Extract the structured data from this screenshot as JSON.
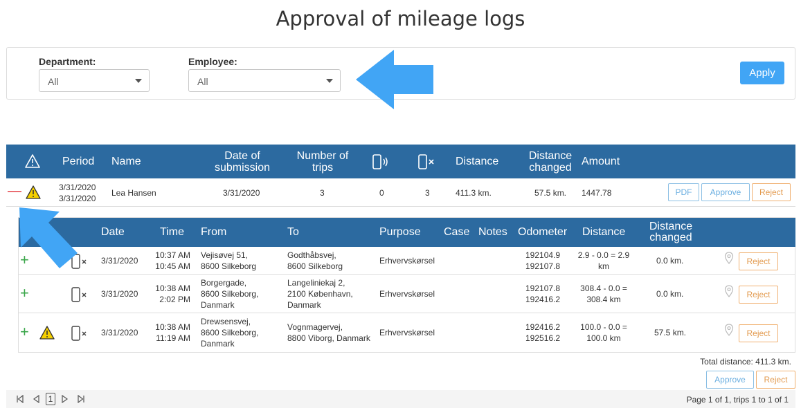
{
  "page": {
    "title": "Approval of mileage logs"
  },
  "filters": {
    "department_label": "Department:",
    "department_value": "All",
    "employee_label": "Employee:",
    "employee_value": "All",
    "apply_label": "Apply"
  },
  "colors": {
    "header": "#2c6aa0",
    "accent": "#41a5f5",
    "arrow": "#41a5f5",
    "reject": "#e39b50",
    "plus": "#3aa64a",
    "minus": "#e2333b"
  },
  "main_table": {
    "headers": {
      "warning": "warning-icon",
      "period": "Period",
      "name": "Name",
      "date_submission_1": "Date of",
      "date_submission_2": "submission",
      "trips_1": "Number of",
      "trips_2": "trips",
      "distance": "Distance",
      "changed_1": "Distance",
      "changed_2": "changed",
      "amount": "Amount"
    },
    "row": {
      "period_from": "3/31/2020",
      "period_to": "3/31/2020",
      "name": "Lea Hansen",
      "date_submission": "3/31/2020",
      "trips": "3",
      "auto_trips": "0",
      "manual_trips": "3",
      "distance": "411.3 km.",
      "distance_changed": "57.5 km.",
      "amount": "1447.78",
      "pdf_label": "PDF",
      "approve_label": "Approve",
      "reject_label": "Reject"
    }
  },
  "trip_table": {
    "headers": {
      "date": "Date",
      "time": "Time",
      "from": "From",
      "to": "To",
      "purpose": "Purpose",
      "case": "Case",
      "notes": "Notes",
      "odometer": "Odometer",
      "distance": "Distance",
      "changed_1": "Distance",
      "changed_2": "changed"
    },
    "rows": [
      {
        "date": "3/31/2020",
        "time_start": "10:37 AM",
        "time_end": "10:45 AM",
        "from_1": "Vejisøvej 51,",
        "from_2": "8600 Silkeborg",
        "from_3": "",
        "to_1": "Godthåbsvej,",
        "to_2": "8600 Silkeborg",
        "to_3": "",
        "purpose": "Erhvervskørsel",
        "odo_start": "192104.9",
        "odo_end": "192107.8",
        "dist_1": "2.9 - 0.0 = 2.9",
        "dist_2": "km",
        "changed": "0.0 km.",
        "reject_label": "Reject"
      },
      {
        "date": "3/31/2020",
        "time_start": "10:38 AM",
        "time_end": "2:02 PM",
        "from_1": "Borgergade,",
        "from_2": "8600 Silkeborg,",
        "from_3": "Danmark",
        "to_1": "Langeliniekaj 2,",
        "to_2": "2100 København,",
        "to_3": "Danmark",
        "purpose": "Erhvervskørsel",
        "odo_start": "192107.8",
        "odo_end": "192416.2",
        "dist_1": "308.4 - 0.0 =",
        "dist_2": "308.4 km",
        "changed": "0.0 km.",
        "reject_label": "Reject"
      },
      {
        "date": "3/31/2020",
        "time_start": "10:38 AM",
        "time_end": "11:19 AM",
        "from_1": "Drewsensvej,",
        "from_2": "8600 Silkeborg,",
        "from_3": "Danmark",
        "to_1": "Vognmagervej,",
        "to_2": "8800 Viborg, Danmark",
        "to_3": "",
        "purpose": "Erhvervskørsel",
        "odo_start": "192416.2",
        "odo_end": "192516.2",
        "dist_1": "100.0 - 0.0 =",
        "dist_2": "100.0 km",
        "changed": "57.5 km.",
        "reject_label": "Reject"
      }
    ]
  },
  "totals": {
    "total_distance": "Total distance: 411.3 km.",
    "approve_label": "Approve",
    "reject_label": "Reject"
  },
  "pager": {
    "current_page": "1",
    "info": "Page 1 of 1, trips 1 to 1 of 1"
  }
}
